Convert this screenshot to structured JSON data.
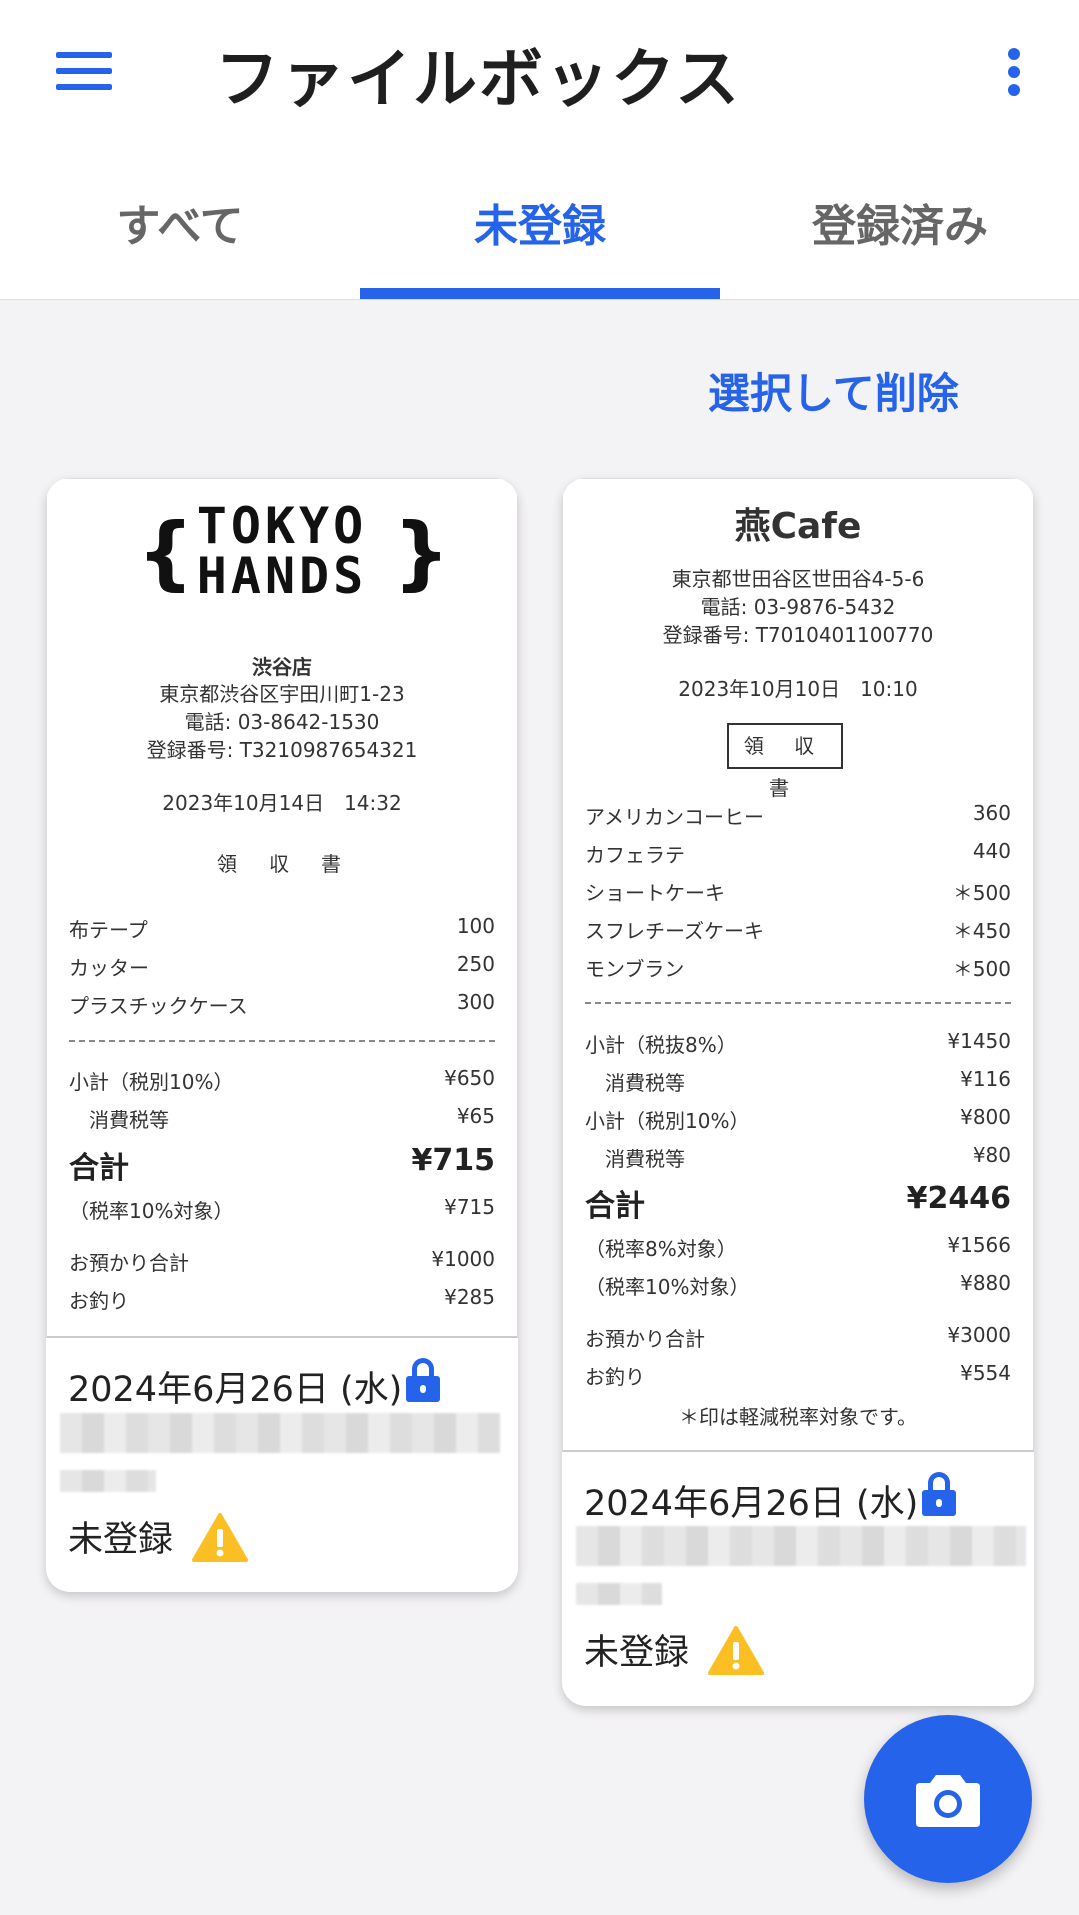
{
  "header": {
    "title": "ファイルボックス"
  },
  "tabs": [
    {
      "label": "すべて",
      "active": false
    },
    {
      "label": "未登録",
      "active": true
    },
    {
      "label": "登録済み",
      "active": false
    }
  ],
  "actions": {
    "delete_label": "選択して削除"
  },
  "colors": {
    "accent": "#2563eb",
    "warning": "#fbbf24",
    "background": "#f3f2f4"
  },
  "cards": [
    {
      "receipt": {
        "logo_line1": "TOKYO",
        "logo_line2": "HANDS",
        "branch": "渋谷店",
        "address": "東京都渋谷区宇田川町1-23",
        "phone": "電話: 03-8642-1530",
        "reg_no": "登録番号: T3210987654321",
        "datetime": "2023年10月14日　14:32",
        "doc_title": "領　収　書",
        "items": [
          {
            "name": "布テープ",
            "price": "100"
          },
          {
            "name": "カッター",
            "price": "250"
          },
          {
            "name": "プラスチックケース",
            "price": "300"
          }
        ],
        "subtotal_label": "小計（税別10%）",
        "subtotal": "¥650",
        "tax_label": "消費税等",
        "tax": "¥65",
        "total_label": "合計",
        "total": "¥715",
        "taxbase_label": "（税率10%対象）",
        "taxbase": "¥715",
        "paid_label": "お預かり合計",
        "paid": "¥1000",
        "change_label": "お釣り",
        "change": "¥285"
      },
      "date": "2024年6月26日 (水)",
      "lock_icon": "lock-icon",
      "status": "未登録",
      "status_icon": "warning-icon"
    },
    {
      "receipt": {
        "shop": "燕Cafe",
        "address": "東京都世田谷区世田谷4-5-6",
        "phone": "電話: 03-9876-5432",
        "reg_no": "登録番号: T7010401100770",
        "datetime": "2023年10月10日　10:10",
        "doc_title": "領 収 書",
        "items": [
          {
            "name": "アメリカンコーヒー",
            "price": "360"
          },
          {
            "name": "カフェラテ",
            "price": "440"
          },
          {
            "name": "ショートケーキ",
            "price": "＊500"
          },
          {
            "name": "スフレチーズケーキ",
            "price": "＊450"
          },
          {
            "name": "モンブラン",
            "price": "＊500"
          }
        ],
        "subtotal8_label": "小計（税抜8%）",
        "subtotal8": "¥1450",
        "tax8_label": "消費税等",
        "tax8": "¥116",
        "subtotal10_label": "小計（税別10%）",
        "subtotal10": "¥800",
        "tax10_label": "消費税等",
        "tax10": "¥80",
        "total_label": "合計",
        "total": "¥2446",
        "taxbase8_label": "（税率8%対象）",
        "taxbase8": "¥1566",
        "taxbase10_label": "（税率10%対象）",
        "taxbase10": "¥880",
        "paid_label": "お預かり合計",
        "paid": "¥3000",
        "change_label": "お釣り",
        "change": "¥554",
        "note": "＊印は軽減税率対象です。"
      },
      "date": "2024年6月26日 (水)",
      "lock_icon": "lock-icon",
      "status": "未登録",
      "status_icon": "warning-icon"
    }
  ],
  "fab": {
    "icon": "camera-icon"
  }
}
